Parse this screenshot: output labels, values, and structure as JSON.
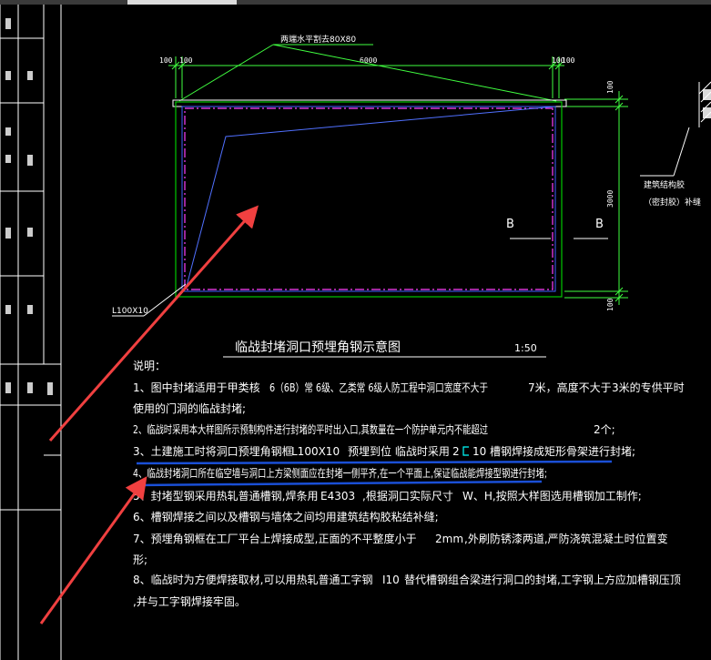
{
  "drawing": {
    "leader_label": "两端水平割去80X80",
    "dim_top": [
      "100",
      "100",
      "6000",
      "100",
      "100"
    ],
    "dim_right": [
      "100",
      "3000",
      "100"
    ],
    "section_label_left": "B",
    "section_label_right": "B",
    "angle_label": "L100X10",
    "building_note_line1": "建筑结构胶",
    "building_note_line2": "（密封胶）补缝",
    "title": "临战封堵洞口预埋角钢示意图",
    "scale": "1:50"
  },
  "notes": {
    "heading": "说明：",
    "n1a": "1、图中封堵适用于甲类核",
    "n1b": "6（6B）常 6级、乙类常 6级人防工程中洞口宽度不大于",
    "n1c": "7米，高度不大于",
    "n1d": "3米的专供平时",
    "n1e": "使用的门洞的临战封堵;",
    "n2a": "2、临战时采用本大样图所示预制构件进行封堵的平时出入口,其数量在一个防护单元内不能超过",
    "n2b": "2个;",
    "n3a": "3、土建施工时将洞口预埋角钢框",
    "n3b": "L100X10",
    "n3c": "预埋到位 临战时采用",
    "n3d": "2",
    "n3e": "10",
    "n3f": "槽钢焊接成矩形骨架进行封堵;",
    "n4": "4、临战封堵洞口所在临空墙与洞口上方梁侧面应在封堵一侧平齐,在一个平面上,保证临战能焊接型钢进行封堵;",
    "n5a": "5、封堵型钢采用热轧普通槽钢,焊条用",
    "n5b": "E4303",
    "n5c": ",根据洞口实际尺寸",
    "n5d": "W、H,按照大样图选用槽钢加工制作;",
    "n6": "6、槽钢焊接之间以及槽钢与墙体之间均用建筑结构胶粘结补缝;",
    "n7a": "7、预埋角钢框在工厂平台上焊接成型,正面的不平整度小于",
    "n7b": "2mm",
    "n7c": ",外刷防锈漆两道,严防浇筑混凝土时位置变",
    "n7d": "形;",
    "n8a": "8、临战时为方便焊接取材,可以用热轧普通工字钢",
    "n8b": "I10",
    "n8c": "替代槽钢组合梁进行洞口的封堵,工字钢上方应加槽钢压顶",
    "n8d": ",并与工字钢焊接牢固。"
  },
  "colors": {
    "background": "#000000",
    "frame_line": "#ffffff",
    "frame_rect": "#00c800",
    "inner_dashed": "#ff40ff",
    "inner_blue": "#4060ff",
    "dimension": "#40ff40",
    "leader": "#40ff40",
    "rib": "#5070ff",
    "annotation_arrow": "#f04040",
    "highlight_line": "#1a4fd6",
    "section_line": "#ffffff"
  }
}
